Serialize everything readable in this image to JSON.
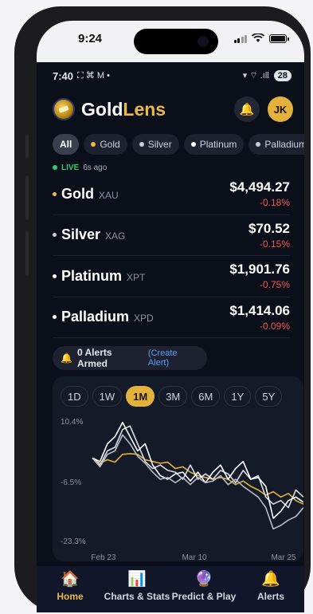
{
  "ios_status": {
    "time": "9:24"
  },
  "android_status": {
    "time": "7:40",
    "notif_icons": "⛶ ⌘ M •",
    "signal_text": "▾ ⌔ .ıll",
    "battery": "28"
  },
  "header": {
    "brand_part1": "Gold",
    "brand_part2": "Lens",
    "avatar_initials": "JK"
  },
  "filters": [
    {
      "label": "All",
      "color": ""
    },
    {
      "label": "Gold",
      "color": "#e9b949"
    },
    {
      "label": "Silver",
      "color": "#c9ccd4"
    },
    {
      "label": "Platinum",
      "color": "#ffffff"
    },
    {
      "label": "Palladium",
      "color": "#c9ccd4"
    }
  ],
  "live": {
    "label": "LIVE",
    "ago": "6s ago"
  },
  "metals": [
    {
      "name": "Gold",
      "symbol": "XAU",
      "price": "$4,494.27",
      "change": "-0.18%",
      "color": "#e9b949"
    },
    {
      "name": "Silver",
      "symbol": "XAG",
      "price": "$70.52",
      "change": "-0.15%",
      "color": "#c9ccd4"
    },
    {
      "name": "Platinum",
      "symbol": "XPT",
      "price": "$1,901.76",
      "change": "-0.75%",
      "color": "#ffffff"
    },
    {
      "name": "Palladium",
      "symbol": "XPD",
      "price": "$1,414.06",
      "change": "-0.09%",
      "color": "#ffffff"
    }
  ],
  "alerts": {
    "text": "0 Alerts Armed",
    "create": "(Create Alert)"
  },
  "ranges": [
    "1D",
    "1W",
    "1M",
    "3M",
    "6M",
    "1Y",
    "5Y"
  ],
  "selected_range": "1M",
  "chart_data": {
    "type": "line",
    "y_ticks": [
      "10.4%",
      "-6.5%",
      "-23.3%"
    ],
    "x_ticks": [
      "Feb 23",
      "Mar 10",
      "Mar 25"
    ],
    "ylim": [
      -23.3,
      10.4
    ],
    "series": [
      {
        "color": "#e3b23c",
        "values": [
          0.0,
          -1.5,
          -0.5,
          -1.2,
          1.0,
          1.2,
          1.0,
          -0.5,
          -1.0,
          -1.5,
          -1.2,
          -3.0,
          -2.5,
          -4.0,
          -5.0,
          -5.5,
          -6.0,
          -5.5,
          -6.0,
          -7.5,
          -6.5,
          -8.0,
          -9.0,
          -10.5,
          -9.5,
          -11.0,
          -10.0,
          -12.0,
          -13.0
        ]
      },
      {
        "color": "#d9dbe2",
        "values": [
          0.0,
          -2.0,
          2.0,
          3.0,
          8.0,
          9.0,
          4.0,
          -1.0,
          -3.0,
          -2.0,
          -3.5,
          -4.0,
          -6.0,
          -2.0,
          -6.0,
          -4.5,
          -6.0,
          -3.5,
          -4.5,
          -7.0,
          -3.5,
          -6.0,
          -5.0,
          -11.0,
          -13.0,
          -12.0,
          -14.0,
          -9.0,
          -11.0
        ]
      },
      {
        "color": "#ffffff",
        "values": [
          0.0,
          -1.0,
          4.0,
          6.0,
          10.0,
          6.0,
          2.0,
          4.0,
          -2.0,
          -5.0,
          -6.0,
          -4.5,
          -4.0,
          -6.5,
          -4.0,
          -7.0,
          -4.0,
          -2.0,
          -6.0,
          -3.0,
          -1.0,
          -6.0,
          -5.5,
          -8.0,
          -17.0,
          -15.0,
          -12.0,
          -11.0,
          -12.5
        ]
      },
      {
        "color": "#b9bcc6",
        "values": [
          0.0,
          -2.5,
          1.0,
          2.0,
          6.5,
          4.0,
          0.5,
          -1.5,
          -4.0,
          -6.0,
          -5.5,
          -7.0,
          -5.5,
          -7.5,
          -5.5,
          -7.0,
          -6.5,
          -5.0,
          -7.5,
          -6.0,
          -8.0,
          -9.5,
          -11.0,
          -14.0,
          -20.0,
          -19.0,
          -17.5,
          -16.5,
          -14.0
        ]
      }
    ]
  },
  "tabs": [
    {
      "label": "Home",
      "icon": "🏠"
    },
    {
      "label": "Charts & Stats",
      "icon": "📊"
    },
    {
      "label": "Predict & Play",
      "icon": "🔮"
    },
    {
      "label": "Alerts",
      "icon": "🔔"
    }
  ]
}
